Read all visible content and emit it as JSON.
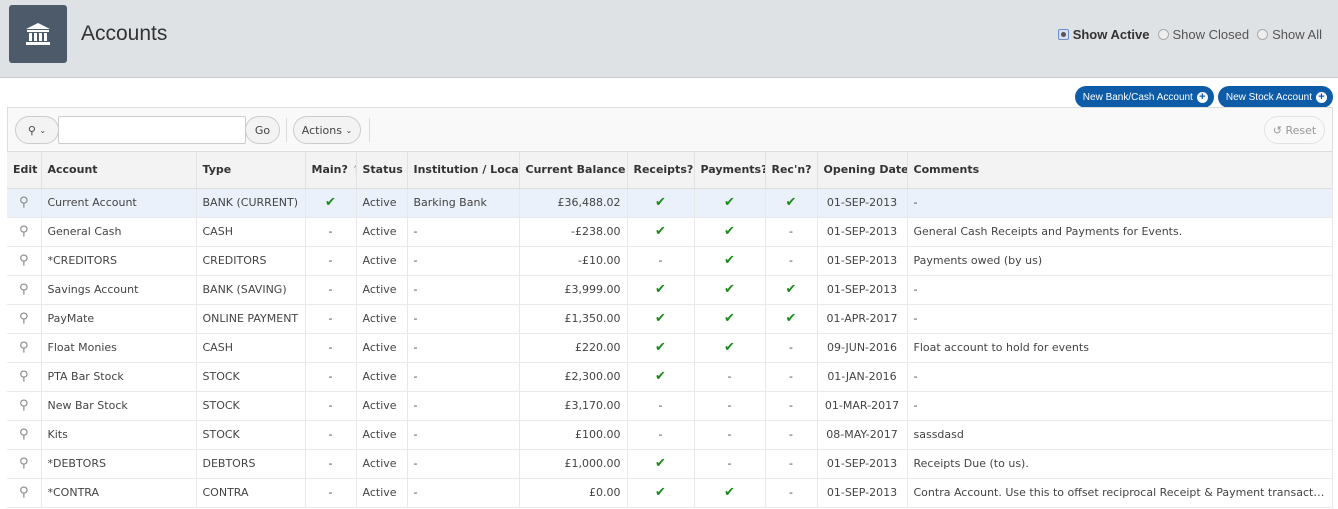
{
  "header": {
    "title": "Accounts",
    "filters": [
      {
        "label": "Show Active",
        "selected": true
      },
      {
        "label": "Show Closed",
        "selected": false
      },
      {
        "label": "Show All",
        "selected": false
      }
    ]
  },
  "buttons": {
    "new_bank": "New Bank/Cash Account",
    "new_stock": "New Stock Account"
  },
  "toolbar": {
    "go": "Go",
    "actions": "Actions",
    "reset": "Reset",
    "search_value": ""
  },
  "columns": [
    "Edit",
    "Account",
    "Type",
    "Main?",
    "Status",
    "Institution / Loca...",
    "Current Balance",
    "Receipts?",
    "Payments?",
    "Rec'n?",
    "Opening Date",
    "Comments"
  ],
  "rows": [
    {
      "account": "Current Account",
      "type": "BANK (CURRENT)",
      "main": "Y",
      "status": "Active",
      "institution": "Barking Bank",
      "balance": "£36,488.02",
      "receipts": "Y",
      "payments": "Y",
      "recn": "Y",
      "opening": "01-SEP-2013",
      "comments": "-"
    },
    {
      "account": "General Cash",
      "type": "CASH",
      "main": "-",
      "status": "Active",
      "institution": "-",
      "balance": "-£238.00",
      "receipts": "Y",
      "payments": "Y",
      "recn": "-",
      "opening": "01-SEP-2013",
      "comments": "General Cash Receipts and Payments for Events."
    },
    {
      "account": "*CREDITORS",
      "type": "CREDITORS",
      "main": "-",
      "status": "Active",
      "institution": "-",
      "balance": "-£10.00",
      "receipts": "-",
      "payments": "Y",
      "recn": "-",
      "opening": "01-SEP-2013",
      "comments": "Payments owed (by us)"
    },
    {
      "account": "Savings Account",
      "type": "BANK (SAVING)",
      "main": "-",
      "status": "Active",
      "institution": "-",
      "balance": "£3,999.00",
      "receipts": "Y",
      "payments": "Y",
      "recn": "Y",
      "opening": "01-SEP-2013",
      "comments": "-"
    },
    {
      "account": "PayMate",
      "type": "ONLINE PAYMENT",
      "main": "-",
      "status": "Active",
      "institution": "-",
      "balance": "£1,350.00",
      "receipts": "Y",
      "payments": "Y",
      "recn": "Y",
      "opening": "01-APR-2017",
      "comments": "-"
    },
    {
      "account": "Float Monies",
      "type": "CASH",
      "main": "-",
      "status": "Active",
      "institution": "-",
      "balance": "£220.00",
      "receipts": "Y",
      "payments": "Y",
      "recn": "-",
      "opening": "09-JUN-2016",
      "comments": "Float account to hold for events"
    },
    {
      "account": "PTA Bar Stock",
      "type": "STOCK",
      "main": "-",
      "status": "Active",
      "institution": "-",
      "balance": "£2,300.00",
      "receipts": "Y",
      "payments": "-",
      "recn": "-",
      "opening": "01-JAN-2016",
      "comments": "-"
    },
    {
      "account": "New Bar Stock",
      "type": "STOCK",
      "main": "-",
      "status": "Active",
      "institution": "-",
      "balance": "£3,170.00",
      "receipts": "-",
      "payments": "-",
      "recn": "-",
      "opening": "01-MAR-2017",
      "comments": "-"
    },
    {
      "account": "Kits",
      "type": "STOCK",
      "main": "-",
      "status": "Active",
      "institution": "-",
      "balance": "£100.00",
      "receipts": "-",
      "payments": "-",
      "recn": "-",
      "opening": "08-MAY-2017",
      "comments": "sassdasd"
    },
    {
      "account": "*DEBTORS",
      "type": "DEBTORS",
      "main": "-",
      "status": "Active",
      "institution": "-",
      "balance": "£1,000.00",
      "receipts": "Y",
      "payments": "-",
      "recn": "-",
      "opening": "01-SEP-2013",
      "comments": "Receipts Due (to us)."
    },
    {
      "account": "*CONTRA",
      "type": "CONTRA",
      "main": "-",
      "status": "Active",
      "institution": "-",
      "balance": "£0.00",
      "receipts": "Y",
      "payments": "Y",
      "recn": "-",
      "opening": "01-SEP-2013",
      "comments": "Contra Account. Use this to offset reciprocal Receipt & Payment transactions where no ..."
    }
  ]
}
